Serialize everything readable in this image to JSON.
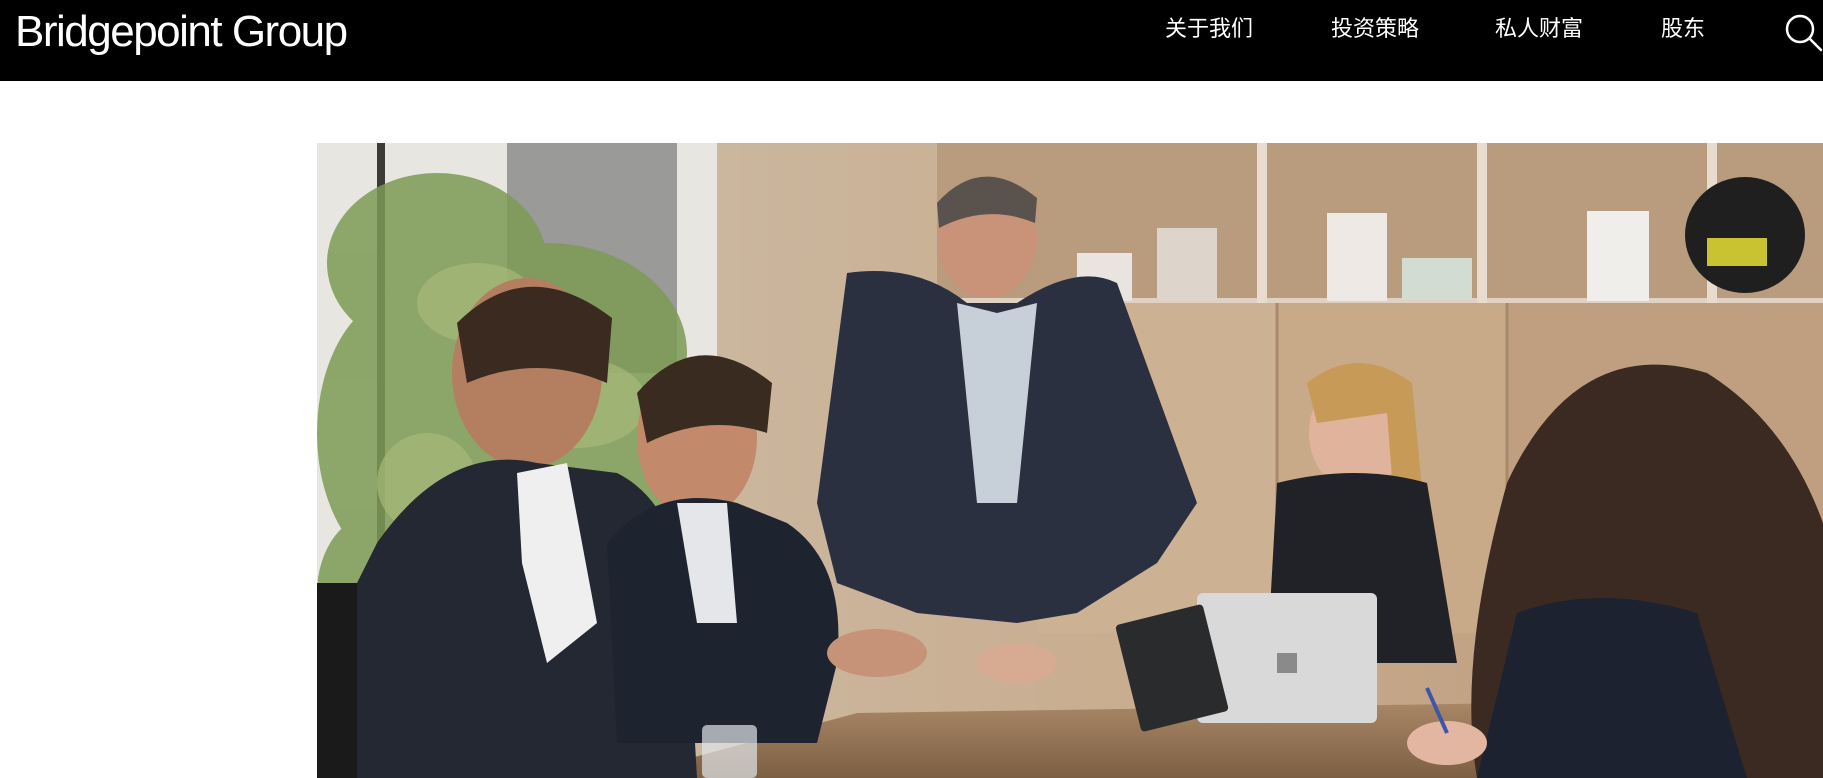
{
  "header": {
    "logo_text": "Bridgepoint Group",
    "nav": [
      {
        "label": "关于我们"
      },
      {
        "label": "投资策略"
      },
      {
        "label": "私人财富"
      },
      {
        "label": "股东"
      }
    ],
    "search_icon": "search-icon"
  },
  "colors": {
    "header_bg": "#000000",
    "header_text": "#ffffff",
    "page_bg": "#ffffff"
  },
  "hero": {
    "alt": "Team meeting around a conference table"
  }
}
